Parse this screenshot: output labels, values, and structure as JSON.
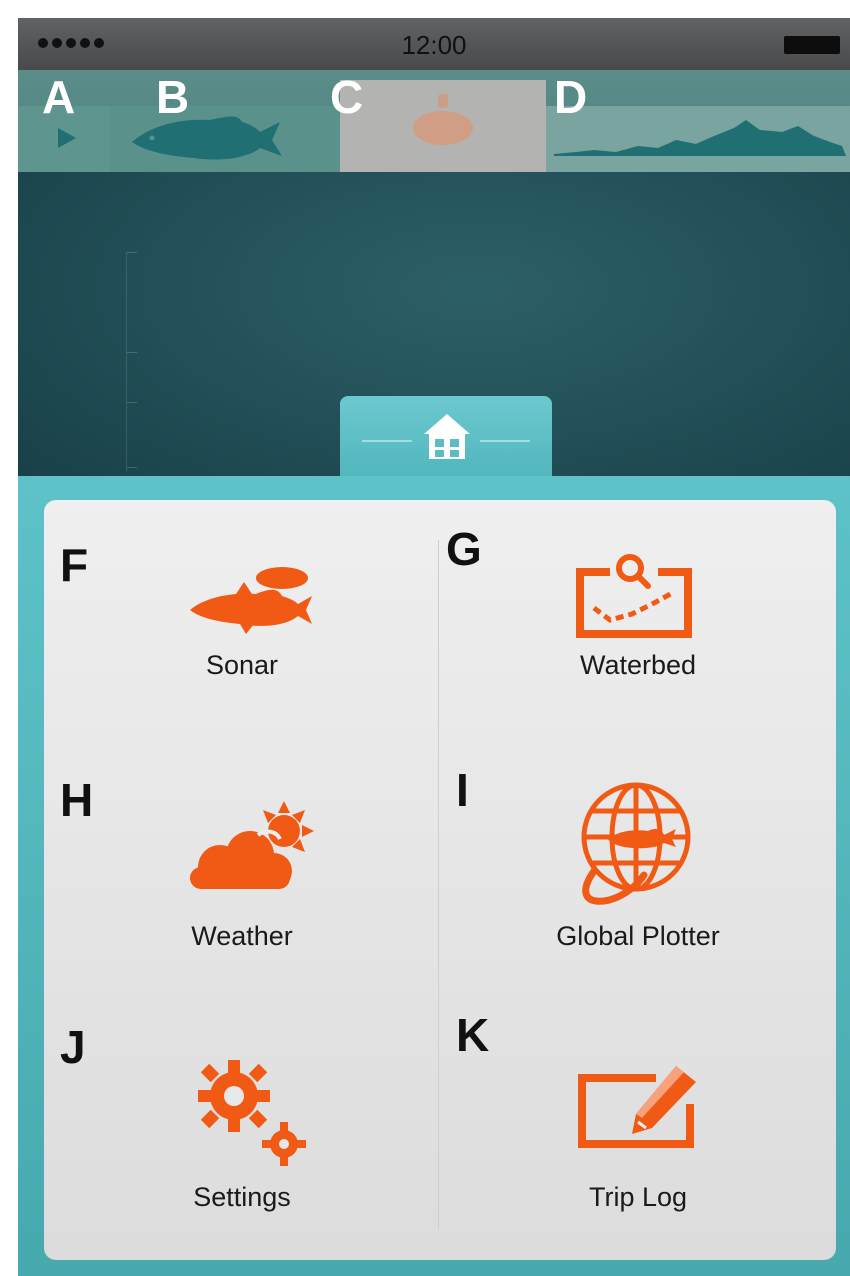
{
  "status_bar": {
    "time": "12:00"
  },
  "top_strip": {
    "labels": [
      "A",
      "B",
      "C",
      "D"
    ]
  },
  "menu": {
    "items": [
      {
        "letter": "F",
        "label": "Sonar",
        "icon": "sonar-fish-icon"
      },
      {
        "letter": "G",
        "label": "Waterbed",
        "icon": "waterbed-map-icon"
      },
      {
        "letter": "H",
        "label": "Weather",
        "icon": "weather-cloud-sun-icon"
      },
      {
        "letter": "I",
        "label": "Global Plotter",
        "icon": "globe-plotter-icon"
      },
      {
        "letter": "J",
        "label": "Settings",
        "icon": "gears-icon"
      },
      {
        "letter": "K",
        "label": "Trip Log",
        "icon": "trip-log-pencil-icon"
      }
    ]
  },
  "colors": {
    "accent_orange": "#f05a14",
    "teal_panel": "#5ec3c8",
    "water_dark": "#1e4a52",
    "fish_teal": "#1f6f73"
  }
}
